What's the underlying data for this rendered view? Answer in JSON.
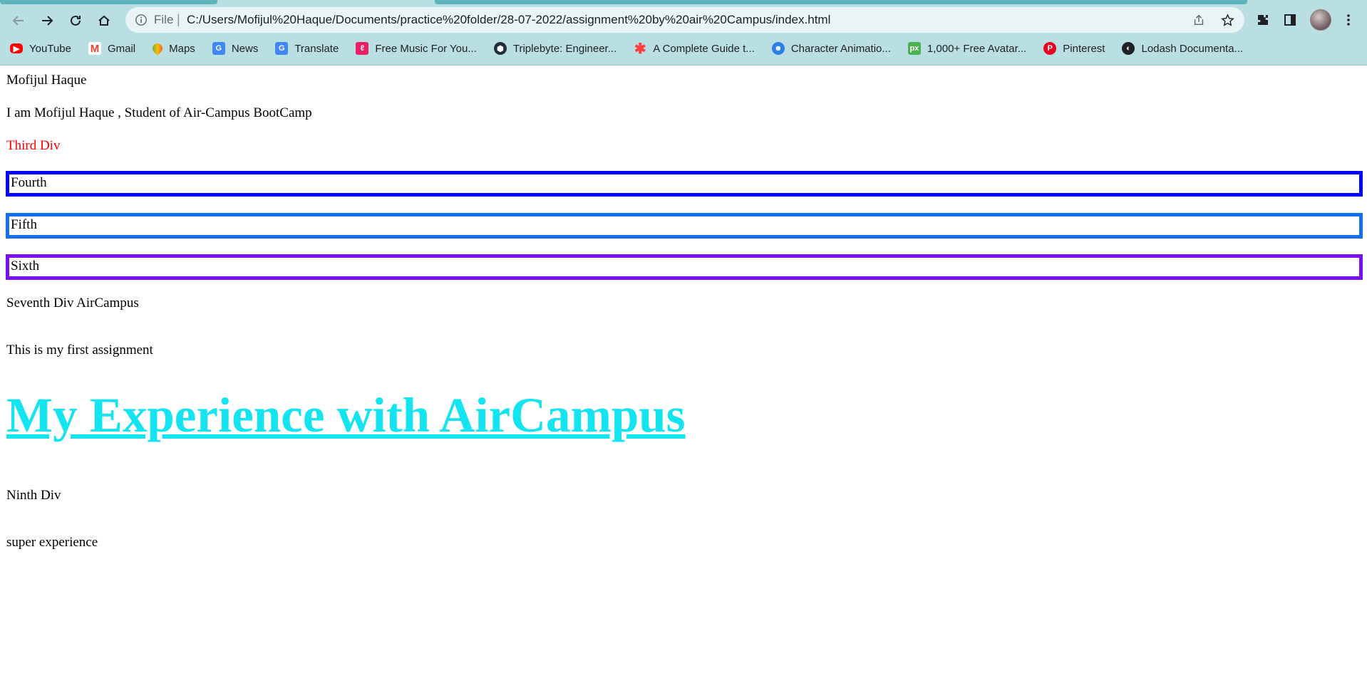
{
  "browser": {
    "url_scheme_label": "File",
    "url": "C:/Users/Mofijul%20Haque/Documents/practice%20folder/28-07-2022/assignment%20by%20air%20Campus/index.html",
    "bookmarks": [
      {
        "label": "YouTube",
        "icon": "youtube-icon",
        "color": "#ff0000"
      },
      {
        "label": "Gmail",
        "icon": "gmail-icon",
        "color": "#ea4335"
      },
      {
        "label": "Maps",
        "icon": "maps-icon",
        "color": "#34a853"
      },
      {
        "label": "News",
        "icon": "news-icon",
        "color": "#4285f4"
      },
      {
        "label": "Translate",
        "icon": "translate-icon",
        "color": "#4285f4"
      },
      {
        "label": "Free Music For You...",
        "icon": "music-icon",
        "color": "#e91e63"
      },
      {
        "label": "Triplebyte: Engineer...",
        "icon": "triplebyte-icon",
        "color": "#1f2d3d"
      },
      {
        "label": "A Complete Guide t...",
        "icon": "asterisk-icon",
        "color": "#ff3d3d"
      },
      {
        "label": "Character Animatio...",
        "icon": "animation-icon",
        "color": "#2b7de9"
      },
      {
        "label": "1,000+ Free Avatar...",
        "icon": "pexels-icon",
        "color": "#4caf50"
      },
      {
        "label": "Pinterest",
        "icon": "pinterest-icon",
        "color": "#e60023"
      },
      {
        "label": "Lodash Documenta...",
        "icon": "globe-icon",
        "color": "#202124"
      }
    ]
  },
  "content": {
    "name": "Mofijul Haque",
    "intro": "I am Mofijul Haque , Student of Air-Campus BootCamp",
    "third": "Third Div",
    "fourth": "Fourth",
    "fifth": "Fifth",
    "sixth": "Sixth",
    "seventh": "Seventh Div AirCampus",
    "assignment": "This is my first assignment",
    "heading": "My Experience with AirCampus",
    "ninth": "Ninth Div",
    "experience": "super experience"
  },
  "colors": {
    "third_text": "#ff0000",
    "fourth_border": "#0000ff",
    "fifth_border": "#1670ee",
    "sixth_border": "#7a0ff0",
    "heading": "#14e4f0"
  }
}
